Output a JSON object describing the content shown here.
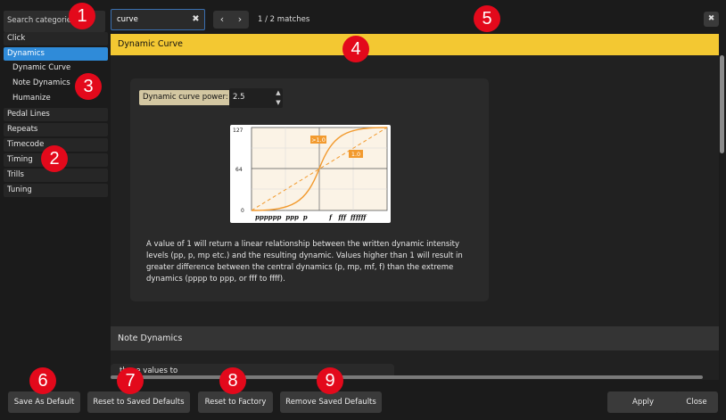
{
  "sidebar": {
    "search_placeholder": "Search categories",
    "categories": [
      "Click",
      "Dynamics",
      "Pedal Lines",
      "Repeats",
      "Timecode",
      "Timing",
      "Trills",
      "Tuning"
    ],
    "subcategories": [
      "Dynamic Curve",
      "Note Dynamics",
      "Humanize"
    ]
  },
  "find": {
    "query": "curve",
    "match_count": "1 / 2 matches"
  },
  "dynamic_curve": {
    "header": "Dynamic Curve",
    "power_label": "Dynamic curve power:",
    "power_value": "2.5",
    "graph": {
      "y_ticks": [
        "127",
        "64",
        "0"
      ],
      "x_labels": "pppppp  ppp  p          f   fff  ffffff",
      "label_high": ">1.0",
      "label_linear": "1.0"
    },
    "description": "A value of 1 will return a linear relationship between the written dynamic intensity levels (pp, p, mp etc.) and the resulting dynamic. Values higher than 1 will result in greater difference between the central dynamics (p, mp, mf, f) than the extreme dynamics (pppp to ppp, or fff to ffff)."
  },
  "note_dynamics": {
    "header": "Note Dynamics",
    "partial_text": "these values to"
  },
  "buttons": {
    "save_default": "Save As Default",
    "reset_saved": "Reset to Saved Defaults",
    "reset_factory": "Reset to Factory",
    "remove_saved": "Remove Saved Defaults",
    "apply": "Apply",
    "close": "Close"
  },
  "markers": [
    "1",
    "2",
    "3",
    "4",
    "5",
    "6",
    "7",
    "8",
    "9"
  ],
  "colors": {
    "accent_blue": "#2f8bd9",
    "header_yellow": "#f3c832",
    "curve_orange": "#f29a2e",
    "marker_red": "#e3091b"
  }
}
